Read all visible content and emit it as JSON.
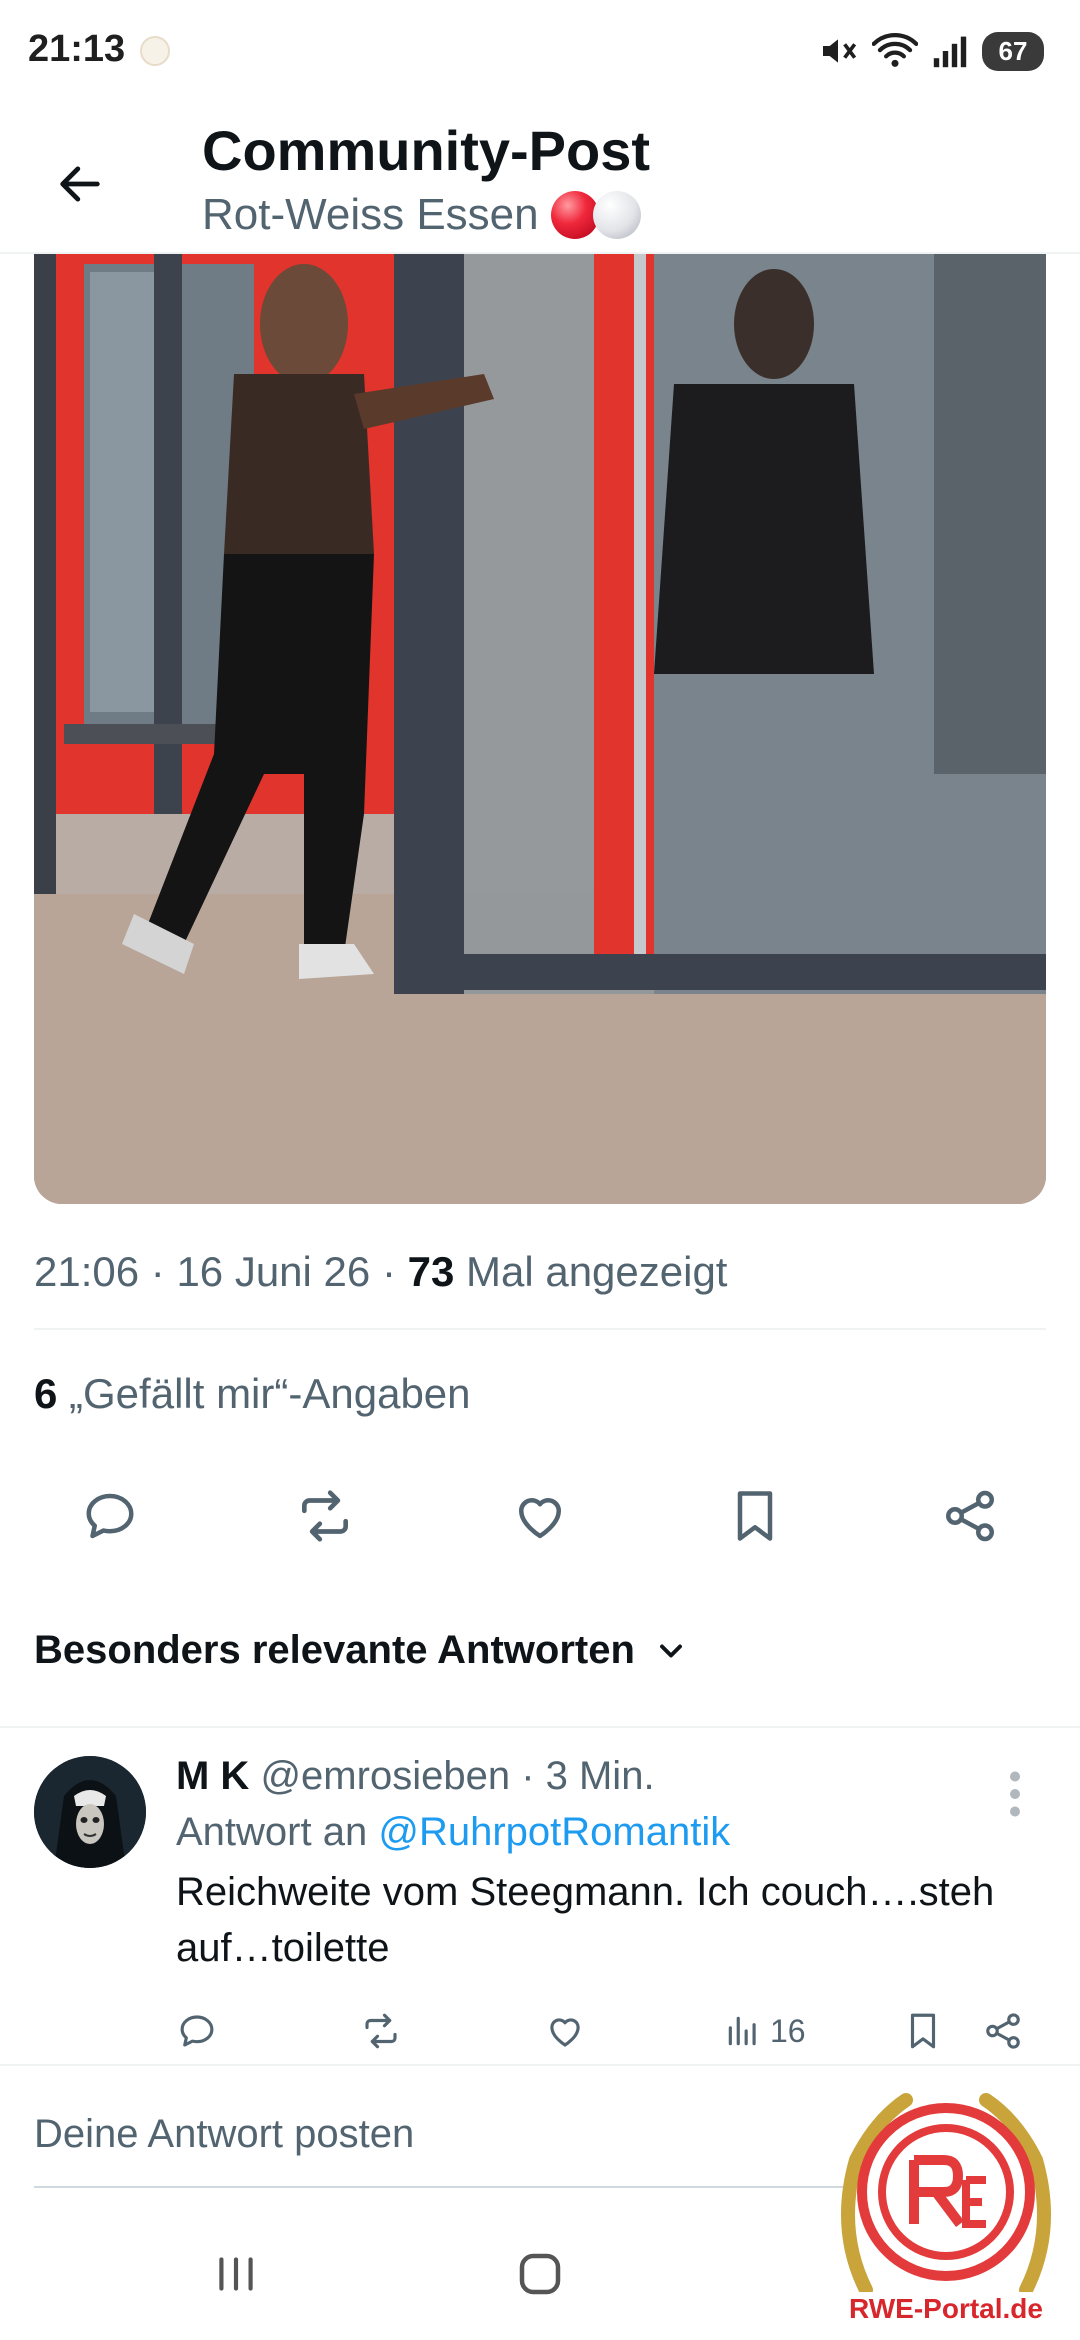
{
  "status_bar": {
    "time": "21:13",
    "battery": "67"
  },
  "header": {
    "title": "Community-Post",
    "subtitle": "Rot-Weiss Essen"
  },
  "post": {
    "time": "21:06",
    "date": "16 Juni 26",
    "views_count": "73",
    "views_label": "Mal angezeigt",
    "likes_count": "6",
    "likes_label": "„Gefällt mir“-Angaben"
  },
  "sort_label": "Besonders relevante Antworten",
  "reply": {
    "name": "M K",
    "handle": "@emrosieben",
    "time": "3 Min.",
    "reply_to_prefix": "Antwort an",
    "reply_to_handle": "@RuhrpotRomantik",
    "text": "Reichweite vom Steegmann. Ich couch….steh auf…toilette",
    "views": "16"
  },
  "compose_placeholder": "Deine Antwort posten",
  "watermark_text": "RWE-Portal.de",
  "colors": {
    "accent": "#1d9bf0",
    "text": "#0f1419",
    "muted": "#536471",
    "divider": "#eff3f4"
  }
}
